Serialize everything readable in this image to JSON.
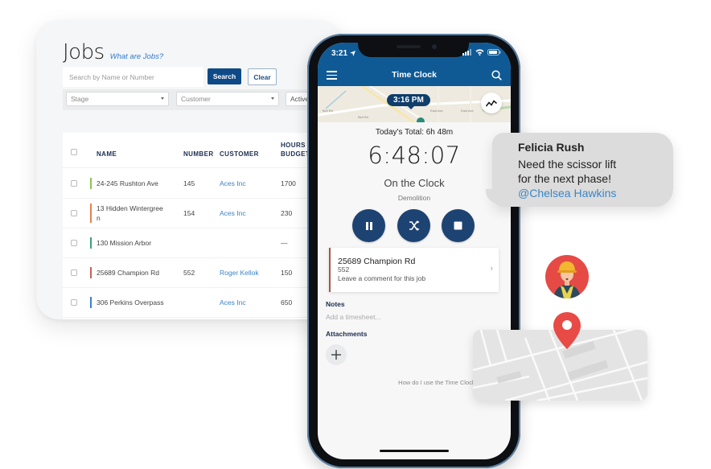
{
  "desktop": {
    "title": "Jobs",
    "help_link": "What are Jobs?",
    "search": {
      "placeholder": "Search by Name or Number",
      "value": ""
    },
    "search_button": "Search",
    "clear_button": "Clear",
    "filters": [
      {
        "label": "Stage"
      },
      {
        "label": "Customer"
      },
      {
        "label": "Active"
      }
    ],
    "table": {
      "columns": [
        "NAME",
        "NUMBER",
        "CUSTOMER",
        "HOURS",
        "BUDGET"
      ],
      "rows": [
        {
          "name": "24-245 Rushton Ave",
          "name_line2": "",
          "number": "145",
          "customer": "Aces Inc",
          "hours_budget": "1700",
          "stage_color": "#8cc152"
        },
        {
          "name": "13 Hidden Wintergree",
          "name_line2": "n",
          "number": "154",
          "customer": "Aces Inc",
          "hours_budget": "230",
          "stage_color": "#e8804f"
        },
        {
          "name": "130 Mission Arbor",
          "name_line2": "",
          "number": "",
          "customer": "",
          "hours_budget": "—",
          "stage_color": "#37a372"
        },
        {
          "name": "25689 Champion Rd",
          "name_line2": "",
          "number": "552",
          "customer": "Roger Kellok",
          "hours_budget": "150",
          "stage_color": "#c0625a"
        },
        {
          "name": "306 Perkins Overpass",
          "name_line2": "",
          "number": "",
          "customer": "Aces Inc",
          "hours_budget": "650",
          "stage_color": "#3b82d1"
        }
      ]
    }
  },
  "phone": {
    "status_time": "3:21",
    "nav_title": "Time Clock",
    "map_time_pill": "3:16 PM",
    "map_labels": [
      "Bell Rd",
      "Bell Rd",
      "East Ave",
      "East Ave",
      "Mud Creek"
    ],
    "todays_total": "Today's Total: 6h 48m",
    "timer": "6:48:07",
    "clock_state": "On the Clock",
    "activity": "Demolition",
    "job": {
      "name": "25689 Champion Rd",
      "number": "552",
      "comment_prompt": "Leave a comment for this job"
    },
    "notes_label": "Notes",
    "notes_placeholder": "Add a timesheet...",
    "attachments_label": "Attachments",
    "help_link": "How do I use the Time Clock?"
  },
  "chat": {
    "author": "Felicia Rush",
    "message_line1": "Need the scissor lift",
    "message_line2": "for the next phase!",
    "mention": "@Chelsea Hawkins"
  },
  "colors": {
    "brand_blue": "#0f5a95",
    "button_navy": "#1d4372",
    "link_blue": "#3a83c9",
    "pin_red": "#e84a45"
  }
}
